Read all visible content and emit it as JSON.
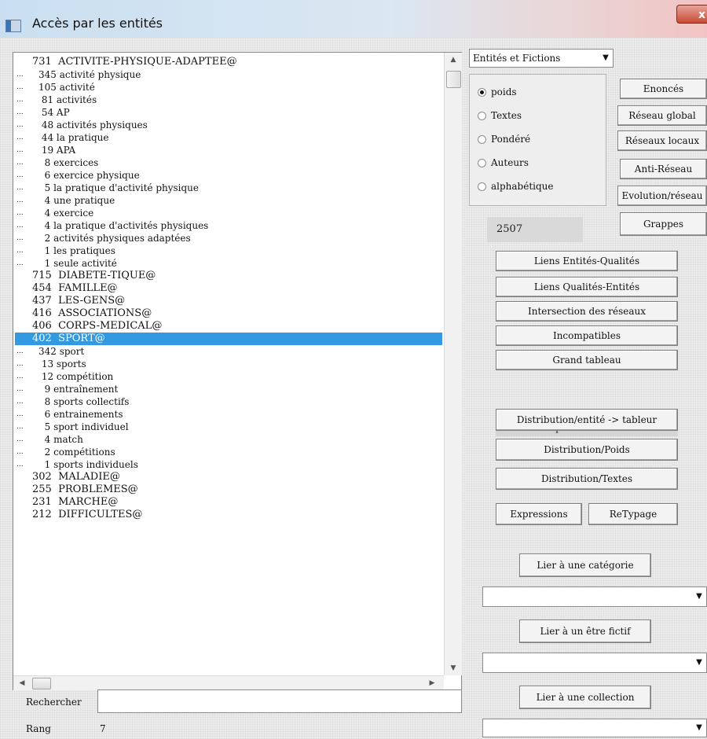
{
  "window": {
    "title": "Accès par les entités",
    "close_label": "x"
  },
  "list": {
    "items": [
      {
        "text": "731  ACTIVITE-PHYSIQUE-ADAPTEE@",
        "level": 0
      },
      {
        "text": "345 activité physique",
        "level": 1
      },
      {
        "text": "105 activité",
        "level": 1
      },
      {
        "text": " 81 activités",
        "level": 1
      },
      {
        "text": " 54 AP",
        "level": 1
      },
      {
        "text": " 48 activités physiques",
        "level": 1
      },
      {
        "text": " 44 la pratique",
        "level": 1
      },
      {
        "text": " 19 APA",
        "level": 1
      },
      {
        "text": "  8 exercices",
        "level": 1
      },
      {
        "text": "  6 exercice physique",
        "level": 1
      },
      {
        "text": "  5 la pratique d'activité physique",
        "level": 1
      },
      {
        "text": "  4 une pratique",
        "level": 1
      },
      {
        "text": "  4 exercice",
        "level": 1
      },
      {
        "text": "  4 la pratique d'activités physiques",
        "level": 1
      },
      {
        "text": "  2 activités physiques adaptées",
        "level": 1
      },
      {
        "text": "  1 les pratiques",
        "level": 1
      },
      {
        "text": "  1 seule activité",
        "level": 1
      },
      {
        "text": "715  DIABETE-TIQUE@",
        "level": 0
      },
      {
        "text": "454  FAMILLE@",
        "level": 0
      },
      {
        "text": "437  LES-GENS@",
        "level": 0
      },
      {
        "text": "416  ASSOCIATIONS@",
        "level": 0
      },
      {
        "text": "406  CORPS-MEDICAL@",
        "level": 0
      },
      {
        "text": "402  SPORT@",
        "level": 0,
        "selected": true
      },
      {
        "text": "342 sport",
        "level": 1
      },
      {
        "text": " 13 sports",
        "level": 1
      },
      {
        "text": " 12 compétition",
        "level": 1
      },
      {
        "text": "  9 entraînement",
        "level": 1
      },
      {
        "text": "  8 sports collectifs",
        "level": 1
      },
      {
        "text": "  6 entrainements",
        "level": 1
      },
      {
        "text": "  5 sport individuel",
        "level": 1
      },
      {
        "text": "  4 match",
        "level": 1
      },
      {
        "text": "  2 compétitions",
        "level": 1
      },
      {
        "text": "  1 sports individuels",
        "level": 1
      },
      {
        "text": "302  MALADIE@",
        "level": 0
      },
      {
        "text": "255  PROBLEMES@",
        "level": 0
      },
      {
        "text": "231  MARCHE@",
        "level": 0
      },
      {
        "text": "212  DIFFICULTES@",
        "level": 0
      }
    ],
    "dots": "..."
  },
  "type_dropdown": {
    "value": "Entités et Fictions",
    "arrow": "▼"
  },
  "sort_options": [
    {
      "label": "poids",
      "checked": true
    },
    {
      "label": "Textes",
      "checked": false
    },
    {
      "label": "Pondéré",
      "checked": false
    },
    {
      "label": "Auteurs",
      "checked": false
    },
    {
      "label": "alphabétique",
      "checked": false
    }
  ],
  "right_buttons": {
    "enonces": "Enoncés",
    "reseau_global": "Réseau global",
    "reseaux_locaux": "Réseaux locaux",
    "anti_reseau": "Anti-Réseau",
    "evolution": "Evolution/réseau",
    "grappes": "Grappes"
  },
  "count": "2507",
  "center_buttons": {
    "liens_eq": "Liens Entités-Qualités",
    "liens_qe": "Liens Qualités-Entités",
    "intersection": "Intersection des réseaux",
    "incompatibles": "Incompatibles",
    "grand_tableau": "Grand tableau",
    "copie_label": "Copie vers tableur",
    "distribution_entite": "Distribution/entité -> tableur",
    "distribution_poids": "Distribution/Poids",
    "distribution_textes": "Distribution/Textes",
    "expressions": "Expressions",
    "retypage": "ReTypage",
    "lier_categorie": "Lier à une catégorie",
    "lier_fictif": "Lier à un être fictif",
    "lier_collection": "Lier à une collection"
  },
  "search": {
    "label": "Rechercher",
    "value": ""
  },
  "rank": {
    "label": "Rang",
    "value": "7"
  },
  "arrows": {
    "up": "▲",
    "down": "▼",
    "left": "◀",
    "right": "▶",
    "combo": "▼"
  }
}
